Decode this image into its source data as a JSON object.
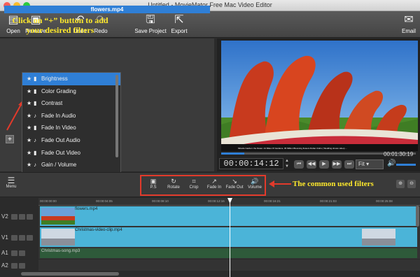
{
  "window": {
    "title": "Untitled - MovieMator Free Mac Video Editor"
  },
  "toolbar": {
    "open": "Open",
    "remove": "Remove",
    "undo": "Undo",
    "redo": "Redo",
    "save_project": "Save Project",
    "export": "Export",
    "email": "Email"
  },
  "media": {
    "selected_file": "flowers.mp4"
  },
  "annotations": {
    "add_filters": "Click on “+” button to add your desired filters",
    "common_filters": "The common used filters"
  },
  "filters": [
    {
      "name": "Brightness",
      "kind": "video",
      "selected": true
    },
    {
      "name": "Color Grading",
      "kind": "video",
      "selected": false
    },
    {
      "name": "Contrast",
      "kind": "video",
      "selected": false
    },
    {
      "name": "Fade In Audio",
      "kind": "audio",
      "selected": false
    },
    {
      "name": "Fade In Video",
      "kind": "video",
      "selected": false
    },
    {
      "name": "Fade Out Audio",
      "kind": "audio",
      "selected": false
    },
    {
      "name": "Fade Out Video",
      "kind": "video",
      "selected": false
    },
    {
      "name": "Gain / Volume",
      "kind": "audio",
      "selected": false
    }
  ],
  "preview": {
    "timecode": "00:00:14:12",
    "duration": "00:01:30:19",
    "zoom": "Fit",
    "progress": 0.12,
    "subtitle": "Miracle Garden: the flower. 44 Miles Of Gardens. 45 Million Blooming flowers Dubai. bluhs ( Wedding shows video) ..."
  },
  "filterbar": {
    "menu": "Menu",
    "buttons": [
      "P.S",
      "Rotate",
      "Crop",
      "Fade In",
      "Fade Out",
      "Volume"
    ]
  },
  "timeline": {
    "ruler": [
      "00:00:00:00",
      "00:00:04:05",
      "00:00:08:10",
      "00:00:12:16",
      "00:00:16:21",
      "00:00:21:03",
      "00:00:25:08"
    ],
    "tracks": [
      {
        "label": "V2",
        "clip": "flowers.mp4"
      },
      {
        "label": "V1",
        "clip": "Christmas-video-clip.mp4"
      },
      {
        "label": "A1",
        "clip": "Christmas-song.mp3"
      },
      {
        "label": "A2",
        "clip": ""
      }
    ]
  },
  "colors": {
    "accent": "#2f7fd6",
    "annotation": "#ffe92c",
    "highlight_border": "#e23a2b",
    "video_clip": "#4bb4d8",
    "audio_clip": "#2e5a3a"
  }
}
